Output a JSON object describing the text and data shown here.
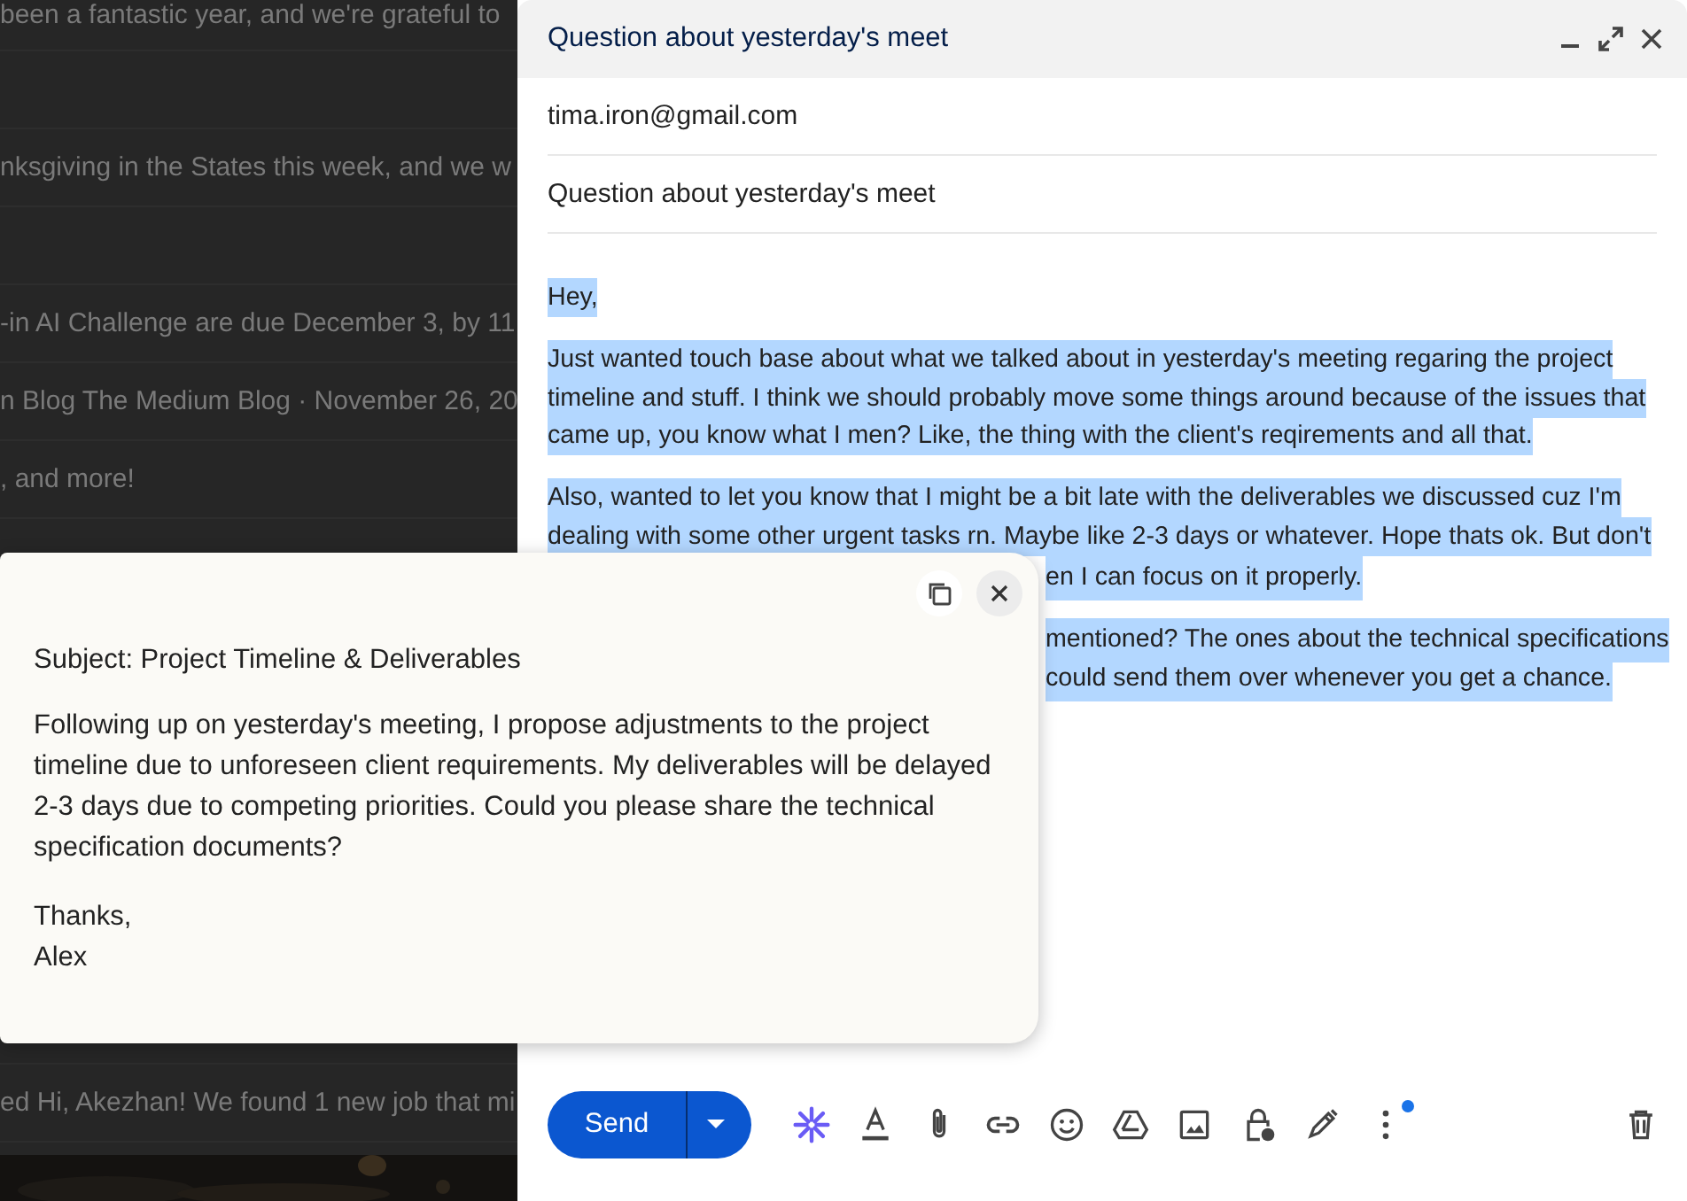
{
  "background_list": {
    "rows": [
      {
        "kind": "snippet",
        "snippet": "been a fantastic year, and we're grateful to"
      },
      {
        "kind": "blank"
      },
      {
        "kind": "snippet",
        "snippet": "nksgiving in the States this week, and we w"
      },
      {
        "kind": "blank"
      },
      {
        "kind": "snippet",
        "snippet": "-in AI Challenge are due December 3, by 11"
      },
      {
        "kind": "snippet",
        "snippet": "n Blog The Medium Blog · November 26, 20"
      },
      {
        "kind": "snippet",
        "snippet": ", and more!"
      },
      {
        "kind": "blank"
      },
      {
        "kind": "blank"
      },
      {
        "kind": "blank"
      },
      {
        "kind": "blank"
      },
      {
        "kind": "blank"
      },
      {
        "kind": "blank"
      },
      {
        "kind": "blank"
      },
      {
        "kind": "snippet",
        "snippet": "ed Hi, Akezhan! We found 1 new job that mi"
      }
    ]
  },
  "compose": {
    "title": "Question about yesterday's meet",
    "to": "tima.iron@gmail.com",
    "subject": "Question about yesterday's meet",
    "body": {
      "selected": true,
      "paragraphs": [
        {
          "lines": [
            {
              "text": "Hey,",
              "covered": false
            }
          ]
        },
        {
          "lines": [
            {
              "text": "Just wanted touch base about what we talked about in yesterday's meeting regaring the project",
              "covered": false
            },
            {
              "text": "timeline and stuff. I think we should probably move some things around because of the issues that",
              "covered": false
            },
            {
              "text": "came up, you know what I men? Like, the thing with the client's reqirements and all that.",
              "covered": false
            }
          ]
        },
        {
          "lines": [
            {
              "text": "Also, wanted to let you know that I might be a bit late with the deliverables we discussed cuz I'm",
              "covered": false
            },
            {
              "text": "dealing with some other urgent tasks rn. Maybe like 2-3 days or whatever. Hope thats ok. But don't",
              "covered": false
            },
            {
              "text": "en I can focus on it properly.",
              "covered": true
            }
          ]
        },
        {
          "lines": [
            {
              "text": "mentioned? The ones about the technical specifications",
              "covered": true
            },
            {
              "text": "could send them over whenever you get a chance.",
              "covered": true
            }
          ]
        }
      ]
    },
    "send_label": "Send",
    "more_options_badge": true
  },
  "suggestion_popup": {
    "subject": "Subject: Project Timeline & Deliverables",
    "paragraph": "Following up on yesterday's meeting, I propose adjustments to the project timeline due to unforeseen client requirements. My deliverables will be delayed 2-3 days due to competing priorities. Could you please share the technical specification documents?",
    "closing": "Thanks,",
    "signature": "Alex"
  }
}
